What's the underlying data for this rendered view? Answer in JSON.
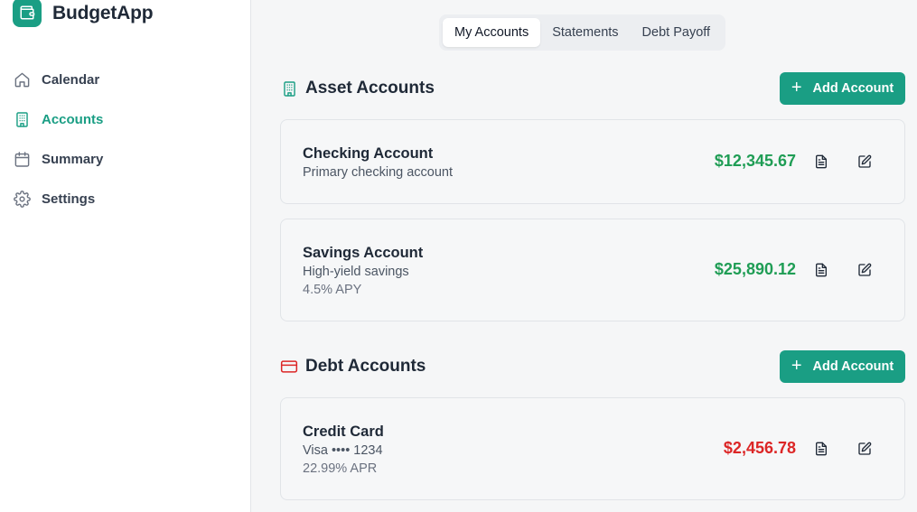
{
  "app": {
    "name": "BudgetApp",
    "logo_icon": "wallet-icon",
    "accent": "#1a9e84"
  },
  "sidebar": {
    "items": [
      {
        "label": "Calendar",
        "icon": "home-icon",
        "active": false
      },
      {
        "label": "Accounts",
        "icon": "building-icon",
        "active": true
      },
      {
        "label": "Summary",
        "icon": "calendar-icon",
        "active": false
      },
      {
        "label": "Settings",
        "icon": "gear-icon",
        "active": false
      }
    ]
  },
  "tabs": [
    {
      "label": "My Accounts",
      "active": true
    },
    {
      "label": "Statements",
      "active": false
    },
    {
      "label": "Debt Payoff",
      "active": false
    }
  ],
  "asset_section": {
    "title": "Asset Accounts",
    "icon": "building-icon",
    "add_label": "Add Account",
    "accounts": [
      {
        "name": "Checking Account",
        "subtitle": "Primary checking account",
        "amount": "$12,345.67"
      },
      {
        "name": "Savings Account",
        "subtitle": "High-yield savings",
        "detail": "4.5% APY",
        "amount": "$25,890.12"
      }
    ]
  },
  "debt_section": {
    "title": "Debt Accounts",
    "icon": "credit-card-icon",
    "add_label": "Add Account",
    "accounts": [
      {
        "name": "Credit Card",
        "subtitle": "Visa •••• 1234",
        "detail": "22.99% APR",
        "amount": "$2,456.78"
      }
    ]
  },
  "colors": {
    "positive": "#1f9d55",
    "negative": "#dc2626",
    "debt_icon": "#dc2626"
  }
}
